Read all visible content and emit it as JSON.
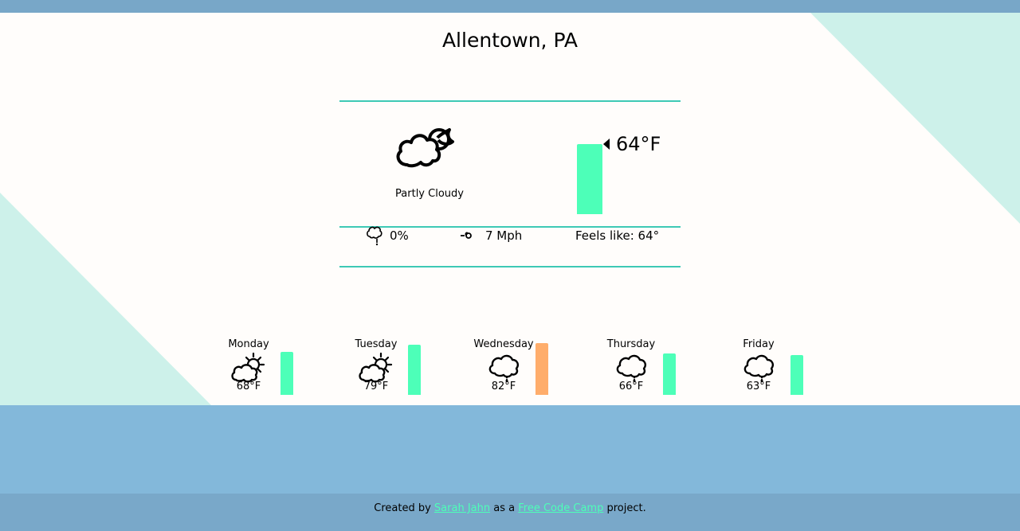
{
  "location": {
    "city": "Allentown, PA"
  },
  "current": {
    "condition": "Partly Cloudy",
    "icon": "partly-cloudy-night-icon",
    "temp": "64°F",
    "temp_bar_color": "#4dffb8",
    "precip": "0%",
    "wind": "7 Mph",
    "feels_like": "Feels like: 64°"
  },
  "forecast": [
    {
      "day": "Monday",
      "temp": "68°F",
      "icon": "partly-sunny-icon",
      "bar_color": "#4dffb8"
    },
    {
      "day": "Tuesday",
      "temp": "79°F",
      "icon": "partly-sunny-icon",
      "bar_color": "#4dffb8"
    },
    {
      "day": "Wednesday",
      "temp": "82°F",
      "icon": "rain-cloud-icon",
      "bar_color": "#ffad6b"
    },
    {
      "day": "Thursday",
      "temp": "66°F",
      "icon": "rain-cloud-icon",
      "bar_color": "#4dffb8"
    },
    {
      "day": "Friday",
      "temp": "63°F",
      "icon": "rain-cloud-icon",
      "bar_color": "#4dffb8"
    }
  ],
  "footer": {
    "prefix": "Created by",
    "author": "Sarah Jahn",
    "middle": "as a",
    "org": "Free Code Camp",
    "suffix": "project."
  }
}
